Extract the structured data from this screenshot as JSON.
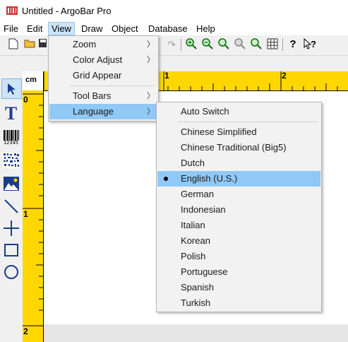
{
  "window": {
    "title": "Untitled - ArgoBar Pro"
  },
  "menubar": {
    "items": [
      {
        "label": "File"
      },
      {
        "label": "Edit"
      },
      {
        "label": "View"
      },
      {
        "label": "Draw"
      },
      {
        "label": "Object"
      },
      {
        "label": "Database"
      },
      {
        "label": "Help"
      }
    ],
    "active": "View"
  },
  "view_menu": {
    "items": [
      {
        "label": "Zoom",
        "submenu": true
      },
      {
        "label": "Color Adjust",
        "submenu": true
      },
      {
        "label": "Grid Appear",
        "submenu": false
      },
      {
        "label": "Tool Bars",
        "submenu": true
      },
      {
        "label": "Language",
        "submenu": true,
        "highlighted": true
      }
    ]
  },
  "language_menu": {
    "items": [
      {
        "label": "Auto Switch"
      },
      {
        "label": "Chinese Simplified"
      },
      {
        "label": "Chinese Traditional (Big5)"
      },
      {
        "label": "Dutch"
      },
      {
        "label": "English (U.S.)",
        "checked": true
      },
      {
        "label": "German"
      },
      {
        "label": "Indonesian"
      },
      {
        "label": "Italian"
      },
      {
        "label": "Korean"
      },
      {
        "label": "Polish"
      },
      {
        "label": "Portuguese"
      },
      {
        "label": "Spanish"
      },
      {
        "label": "Turkish"
      }
    ],
    "selected": "English (U.S.)"
  },
  "ruler": {
    "unit": "cm",
    "top_labels": [
      "1",
      "2"
    ],
    "left_labels": [
      "0",
      "1",
      "2"
    ]
  },
  "palette": {
    "tools": [
      "pointer-icon",
      "text-icon",
      "barcode-icon",
      "2d-barcode-icon",
      "image-icon",
      "line-icon",
      "cross-line-icon",
      "rectangle-icon",
      "ellipse-icon"
    ],
    "text_tool_glyph": "T",
    "barcode_caption": "12345"
  },
  "toolbar": {
    "help_glyph": "?",
    "context_help_glyph": "?"
  },
  "colors": {
    "ruler": "#ffd700",
    "menu_highlight": "#90c8f6",
    "menubar_active": "#cce4f7"
  }
}
